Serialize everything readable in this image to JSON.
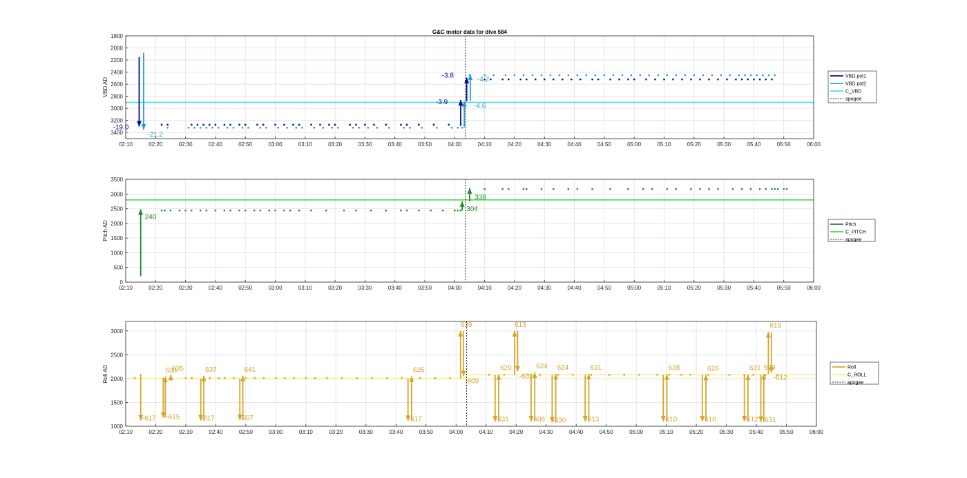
{
  "figure": {
    "title": "G&C motor data for dive 584"
  },
  "colors": {
    "vbd_pot1": "#0a0a8c",
    "vbd_pot2": "#1f9fe0",
    "c_vbd": "#55dde0",
    "pitch": "#1f8a2a",
    "c_pitch": "#44dd44",
    "roll": "#d4a52a",
    "c_roll": "#f5f08a",
    "apogee": "#333333",
    "grid": "#e6e6e6",
    "axis": "#262626"
  },
  "chart_data": [
    {
      "type": "scatter",
      "name": "vbd-panel",
      "ylabel": "VBD AD",
      "ylim": [
        3500,
        1800
      ],
      "y_reversed": true,
      "yticks": [
        "1800",
        "2000",
        "2200",
        "2400",
        "2600",
        "2800",
        "3000",
        "3200",
        "3400"
      ],
      "xlim_min": [
        130,
        360
      ],
      "xticks": [
        "02:10",
        "02:20",
        "02:30",
        "02:40",
        "02:50",
        "03:00",
        "03:10",
        "03:20",
        "03:30",
        "03:40",
        "03:50",
        "04:00",
        "04:10",
        "04:20",
        "04:30",
        "04:40",
        "04:50",
        "05:00",
        "05:10",
        "05:20",
        "05:30",
        "05:40",
        "05:50",
        "06:00"
      ],
      "grid": true,
      "legend": {
        "placement": "right",
        "entries": [
          "VBD pot1",
          "VBD pot2",
          "C_VBD",
          "apogee"
        ]
      },
      "hlines": [
        {
          "series": "C_VBD",
          "y": 2900
        }
      ],
      "apogee_min": 243.5,
      "series": [
        {
          "name": "VBD pot1",
          "y_before": 3270,
          "y_after": 2520,
          "x_before": [
            142,
            144,
            152,
            154,
            156,
            158,
            160,
            163,
            165,
            168,
            170,
            174,
            176,
            180,
            183,
            186,
            188,
            192,
            195,
            198,
            200,
            205,
            207,
            210,
            213,
            217,
            222,
            224,
            228,
            233,
            238,
            242
          ],
          "x_after": [
            250,
            252,
            256,
            258,
            262,
            264,
            267,
            270,
            273,
            276,
            279,
            282,
            286,
            288,
            292,
            295,
            298,
            300,
            304,
            307,
            310,
            313,
            316,
            319,
            322,
            325,
            328,
            331,
            334,
            336,
            338,
            340,
            342,
            344,
            346
          ]
        },
        {
          "name": "VBD pot2",
          "y_before": 3320,
          "y_after": 2450,
          "x_before": [
            144,
            151,
            153,
            155,
            157,
            159,
            161,
            164,
            166,
            169,
            171,
            175,
            177,
            181,
            184,
            187,
            189,
            193,
            196,
            199,
            201,
            206,
            208,
            211,
            214,
            218,
            223,
            225,
            229,
            234,
            239,
            241,
            242.5
          ],
          "x_after": [
            245,
            250,
            253,
            257,
            260,
            263,
            266,
            269,
            272,
            275,
            278,
            281,
            284,
            287,
            290,
            293,
            296,
            299,
            302,
            305,
            308,
            311,
            314,
            317,
            320,
            323,
            326,
            329,
            332,
            335,
            337,
            339,
            341,
            343,
            345,
            347
          ]
        }
      ],
      "arrows": [
        {
          "x": 134.5,
          "y_from": 2150,
          "y_to": 3300,
          "series": "VBD pot1",
          "label": "-19.0",
          "label_dx": -38,
          "label_dy": 4
        },
        {
          "x": 136,
          "y_from": 2080,
          "y_to": 3350,
          "series": "VBD pot2",
          "label": "-21.2",
          "label_dx": 5,
          "label_dy": 10
        },
        {
          "x": 242,
          "y_from": 3270,
          "y_to": 2860,
          "series": "VBD pot1",
          "label": "-3.9",
          "label_dx": -36,
          "label_dy": 6
        },
        {
          "x": 243.2,
          "y_from": 3310,
          "y_to": 2880,
          "series": "VBD pot2",
          "label": "",
          "label_dx": 0,
          "label_dy": 0
        },
        {
          "x": 244,
          "y_from": 2880,
          "y_to": 2490,
          "series": "VBD pot1",
          "label": "-3.8",
          "label_dx": -36,
          "label_dy": 0
        },
        {
          "x": 245.2,
          "y_from": 2880,
          "y_to": 2440,
          "series": "VBD pot2",
          "label": "-4.2",
          "label_dx": 10,
          "label_dy": 10
        },
        {
          "x": 245.5,
          "y_from": 2900,
          "y_to": 2900,
          "series": "VBD pot2",
          "label": "-4.6",
          "label_dx": 4,
          "label_dy": 8
        }
      ]
    },
    {
      "type": "scatter",
      "name": "pitch-panel",
      "ylabel": "Pitch AD",
      "ylim": [
        0,
        3500
      ],
      "y_reversed": false,
      "yticks": [
        "0",
        "500",
        "1000",
        "1500",
        "2000",
        "2500",
        "3000",
        "3500"
      ],
      "xlim_min": [
        130,
        360
      ],
      "xticks": [
        "02:10",
        "02:20",
        "02:30",
        "02:40",
        "02:50",
        "03:00",
        "03:10",
        "03:20",
        "03:30",
        "03:40",
        "03:50",
        "04:00",
        "04:10",
        "04:20",
        "04:30",
        "04:40",
        "04:50",
        "05:00",
        "05:10",
        "05:20",
        "05:30",
        "05:40",
        "05:50",
        "06:00"
      ],
      "grid": true,
      "legend": {
        "placement": "right",
        "entries": [
          "Pitch",
          "C_PITCH",
          "apogee"
        ]
      },
      "hlines": [
        {
          "series": "C_PITCH",
          "y": 2800
        }
      ],
      "apogee_min": 243.5,
      "series": [
        {
          "name": "Pitch",
          "y_before": 2440,
          "y_after": 3170,
          "x_before": [
            142,
            143,
            145,
            148,
            150,
            152,
            155,
            157,
            160,
            163,
            165,
            168,
            170,
            173,
            175,
            178,
            180,
            183,
            185,
            188,
            192,
            197,
            203,
            207,
            212,
            217,
            222,
            224,
            228,
            232,
            236,
            240,
            241,
            242
          ],
          "x_after": [
            250,
            256,
            258,
            263,
            264,
            269,
            273,
            278,
            281,
            286,
            292,
            298,
            303,
            306,
            311,
            314,
            319,
            322,
            325,
            328,
            333,
            336,
            339,
            342,
            344,
            346,
            347,
            348,
            350,
            351
          ]
        }
      ],
      "arrows": [
        {
          "x": 135,
          "y_from": 200,
          "y_to": 2480,
          "series": "Pitch",
          "label": "240",
          "label_dx": 6,
          "label_dy": 14
        },
        {
          "x": 242.5,
          "y_from": 2440,
          "y_to": 2750,
          "series": "Pitch",
          "label": "304",
          "label_dx": 6,
          "label_dy": 14
        },
        {
          "x": 245,
          "y_from": 2750,
          "y_to": 3200,
          "series": "Pitch",
          "label": "338",
          "label_dx": 7,
          "label_dy": 16
        }
      ]
    },
    {
      "type": "scatter",
      "name": "roll-panel",
      "ylabel": "Roll AD",
      "ylim": [
        1000,
        3200
      ],
      "y_reversed": false,
      "yticks": [
        "1000",
        "1500",
        "2000",
        "2500",
        "3000"
      ],
      "xlim_min": [
        130,
        360
      ],
      "xticks": [
        "02:10",
        "02:20",
        "02:30",
        "02:40",
        "02:50",
        "03:00",
        "03:10",
        "03:20",
        "03:30",
        "03:40",
        "03:50",
        "04:00",
        "04:10",
        "04:20",
        "04:30",
        "04:40",
        "04:50",
        "05:00",
        "05:10",
        "05:20",
        "05:30",
        "05:40",
        "05:50",
        "06:00"
      ],
      "grid": true,
      "legend": {
        "placement": "right",
        "entries": [
          "Roll",
          "C_ROLL",
          "apogee"
        ]
      },
      "hlines": [
        {
          "series": "C_ROLL",
          "y_from": 2000,
          "y_to": 2080,
          "x_break": 243
        }
      ],
      "apogee_min": 243.5,
      "series": [
        {
          "name": "Roll",
          "y_before": 2010,
          "y_after": 2080,
          "x_before": [
            133,
            150,
            152,
            156,
            158,
            161,
            163,
            166,
            170,
            173,
            176,
            180,
            183,
            186,
            190,
            193,
            197,
            202,
            207,
            212,
            217,
            222,
            228,
            233,
            238
          ],
          "x_after": [
            251,
            256,
            264,
            268,
            274,
            279,
            285,
            291,
            296,
            301,
            307,
            311,
            315,
            318,
            324,
            331,
            336,
            339,
            343,
            347
          ]
        }
      ],
      "arrows": [
        {
          "x": 135,
          "y_from": 2100,
          "y_to": 1120,
          "series": "Roll",
          "label": "-617",
          "label_dx": 2,
          "label_dy": 0
        },
        {
          "x": 142.5,
          "y_from": 2020,
          "y_to": 1180,
          "series": "Roll",
          "label": "-615",
          "label_dx": 4,
          "label_dy": 2
        },
        {
          "x": 143.2,
          "y_from": 1180,
          "y_to": 2040,
          "series": "Roll",
          "label": "633",
          "label_dx": 0,
          "label_dy": -6
        },
        {
          "x": 145,
          "y_from": 2000,
          "y_to": 2080,
          "series": "Roll",
          "label": "635",
          "label_dx": 2,
          "label_dy": -6
        },
        {
          "x": 155,
          "y_from": 2000,
          "y_to": 1120,
          "series": "Roll",
          "label": "-617",
          "label_dx": 0,
          "label_dy": 0
        },
        {
          "x": 156,
          "y_from": 1120,
          "y_to": 2060,
          "series": "Roll",
          "label": "637",
          "label_dx": 2,
          "label_dy": -6
        },
        {
          "x": 168,
          "y_from": 2000,
          "y_to": 1130,
          "series": "Roll",
          "label": "-607",
          "label_dx": 0,
          "label_dy": 0
        },
        {
          "x": 169,
          "y_from": 1130,
          "y_to": 2060,
          "series": "Roll",
          "label": "641",
          "label_dx": 2,
          "label_dy": -6
        },
        {
          "x": 224,
          "y_from": 2000,
          "y_to": 1110,
          "series": "Roll",
          "label": "-617",
          "label_dx": 0,
          "label_dy": 0
        },
        {
          "x": 225.2,
          "y_from": 1110,
          "y_to": 2050,
          "series": "Roll",
          "label": "635",
          "label_dx": 2,
          "label_dy": -6
        },
        {
          "x": 241.5,
          "y_from": 2000,
          "y_to": 3000,
          "series": "Roll",
          "label": "639",
          "label_dx": 0,
          "label_dy": -6
        },
        {
          "x": 242.5,
          "y_from": 3000,
          "y_to": 2050,
          "series": "Roll",
          "label": "-609",
          "label_dx": 2,
          "label_dy": 10
        },
        {
          "x": 253,
          "y_from": 2080,
          "y_to": 1100,
          "series": "Roll",
          "label": "-631",
          "label_dx": 0,
          "label_dy": 0
        },
        {
          "x": 254.2,
          "y_from": 1100,
          "y_to": 2090,
          "series": "Roll",
          "label": "620",
          "label_dx": 2,
          "label_dy": -6
        },
        {
          "x": 259.5,
          "y_from": 2080,
          "y_to": 3000,
          "series": "Roll",
          "label": "613",
          "label_dx": 0,
          "label_dy": -6
        },
        {
          "x": 260.5,
          "y_from": 3000,
          "y_to": 2150,
          "series": "Roll",
          "label": "-602",
          "label_dx": 2,
          "label_dy": 10
        },
        {
          "x": 265,
          "y_from": 2080,
          "y_to": 1100,
          "series": "Roll",
          "label": "-608",
          "label_dx": 0,
          "label_dy": 0
        },
        {
          "x": 266.2,
          "y_from": 1100,
          "y_to": 2130,
          "series": "Roll",
          "label": "624",
          "label_dx": 2,
          "label_dy": -6
        },
        {
          "x": 272,
          "y_from": 2080,
          "y_to": 1080,
          "series": "Roll",
          "label": "-630",
          "label_dx": 0,
          "label_dy": 0
        },
        {
          "x": 273.2,
          "y_from": 1080,
          "y_to": 2100,
          "series": "Roll",
          "label": "624",
          "label_dx": 2,
          "label_dy": -6
        },
        {
          "x": 283,
          "y_from": 2080,
          "y_to": 1100,
          "series": "Roll",
          "label": "-613",
          "label_dx": 0,
          "label_dy": 0
        },
        {
          "x": 284.2,
          "y_from": 1100,
          "y_to": 2100,
          "series": "Roll",
          "label": "631",
          "label_dx": 2,
          "label_dy": -6
        },
        {
          "x": 309,
          "y_from": 2080,
          "y_to": 1100,
          "series": "Roll",
          "label": "-610",
          "label_dx": 0,
          "label_dy": 0
        },
        {
          "x": 310.2,
          "y_from": 1100,
          "y_to": 2090,
          "series": "Roll",
          "label": "628",
          "label_dx": 2,
          "label_dy": -6
        },
        {
          "x": 322,
          "y_from": 2080,
          "y_to": 1100,
          "series": "Roll",
          "label": "-610",
          "label_dx": 0,
          "label_dy": 0
        },
        {
          "x": 323.2,
          "y_from": 1100,
          "y_to": 2080,
          "series": "Roll",
          "label": "626",
          "label_dx": 2,
          "label_dy": -6
        },
        {
          "x": 336,
          "y_from": 2080,
          "y_to": 1100,
          "series": "Roll",
          "label": "-612",
          "label_dx": 0,
          "label_dy": 0
        },
        {
          "x": 337.2,
          "y_from": 1100,
          "y_to": 2090,
          "series": "Roll",
          "label": "631",
          "label_dx": 2,
          "label_dy": -6
        },
        {
          "x": 341.5,
          "y_from": 2080,
          "y_to": 1090,
          "series": "Roll",
          "label": "-631",
          "label_dx": 2,
          "label_dy": 0
        },
        {
          "x": 342.5,
          "y_from": 1090,
          "y_to": 2100,
          "series": "Roll",
          "label": "629",
          "label_dx": 0,
          "label_dy": -6
        },
        {
          "x": 344,
          "y_from": 2100,
          "y_to": 2980,
          "series": "Roll",
          "label": "618",
          "label_dx": 2,
          "label_dy": -6
        },
        {
          "x": 345,
          "y_from": 2980,
          "y_to": 2120,
          "series": "Roll",
          "label": "-612",
          "label_dx": 3,
          "label_dy": 10
        }
      ]
    }
  ]
}
